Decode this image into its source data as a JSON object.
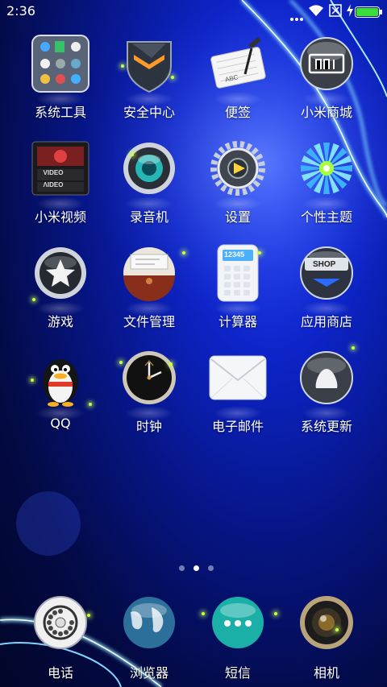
{
  "status": {
    "time": "2:36",
    "icons": [
      "more-icon",
      "wifi-icon",
      "no-sim-icon",
      "charging-icon",
      "battery-icon"
    ],
    "battery_color": "#3ddc3d"
  },
  "apps": [
    {
      "label": "系统工具",
      "icon": "tools-folder-icon"
    },
    {
      "label": "安全中心",
      "icon": "shield-icon"
    },
    {
      "label": "便签",
      "icon": "notes-icon"
    },
    {
      "label": "小米商城",
      "icon": "mi-store-icon"
    },
    {
      "label": "小米视频",
      "icon": "video-icon",
      "icon_text": [
        "VIDEO",
        "VIDEO"
      ]
    },
    {
      "label": "录音机",
      "icon": "recorder-icon"
    },
    {
      "label": "设置",
      "icon": "gear-icon"
    },
    {
      "label": "个性主题",
      "icon": "themes-flower-icon"
    },
    {
      "label": "游戏",
      "icon": "game-star-icon"
    },
    {
      "label": "文件管理",
      "icon": "file-manager-icon"
    },
    {
      "label": "计算器",
      "icon": "calculator-icon",
      "icon_text": "12345"
    },
    {
      "label": "应用商店",
      "icon": "shop-icon",
      "icon_text": "SHOP"
    },
    {
      "label": "QQ",
      "icon": "qq-penguin-icon"
    },
    {
      "label": "时钟",
      "icon": "clock-icon"
    },
    {
      "label": "电子邮件",
      "icon": "email-icon"
    },
    {
      "label": "系统更新",
      "icon": "update-icon"
    }
  ],
  "pager": {
    "count": 3,
    "active": 1
  },
  "dock": [
    {
      "label": "电话",
      "icon": "phone-icon"
    },
    {
      "label": "浏览器",
      "icon": "globe-icon"
    },
    {
      "label": "短信",
      "icon": "message-icon"
    },
    {
      "label": "相机",
      "icon": "camera-lens-icon"
    }
  ],
  "colors": {
    "accent": "#3a8bff",
    "glow": "#7fd4ff",
    "sparkle": "#c9ff4a"
  }
}
